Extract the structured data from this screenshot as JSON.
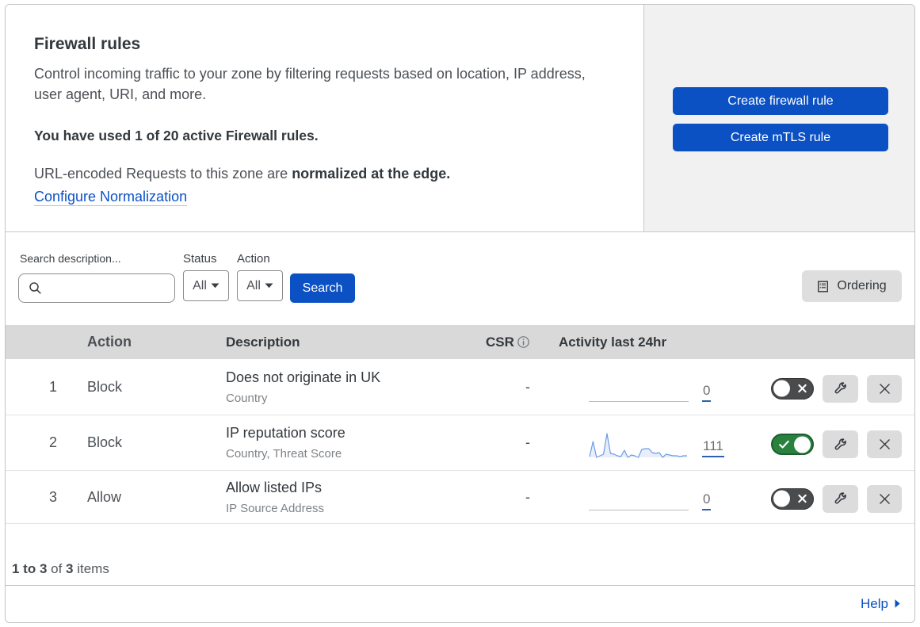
{
  "intro": {
    "title": "Firewall rules",
    "description": "Control incoming traffic to your zone by filtering requests based on location, IP address, user agent, URI, and more.",
    "usage": "You have used 1 of 20 active Firewall rules.",
    "normalization_prefix": "URL-encoded Requests to this zone are ",
    "normalization_bold": "normalized at the edge.",
    "normalization_link": "Configure Normalization"
  },
  "cta": {
    "create_firewall_rule": "Create firewall rule",
    "create_mtls_rule": "Create mTLS rule"
  },
  "filters": {
    "search_label": "Search description...",
    "search_value": "",
    "status_label": "Status",
    "status_value": "All",
    "action_label": "Action",
    "action_value": "All",
    "search_button": "Search",
    "ordering_button": "Ordering"
  },
  "table": {
    "columns": {
      "action": "Action",
      "description": "Description",
      "csr": "CSR",
      "activity": "Activity last 24hr"
    },
    "rows": [
      {
        "index": "1",
        "action": "Block",
        "description": "Does not originate in UK",
        "criteria": "Country",
        "csr": "-",
        "activity_count": "0",
        "enabled": false
      },
      {
        "index": "2",
        "action": "Block",
        "description": "IP reputation score",
        "criteria": "Country, Threat Score",
        "csr": "-",
        "activity_count": "111",
        "enabled": true
      },
      {
        "index": "3",
        "action": "Allow",
        "description": "Allow listed IPs",
        "criteria": "IP Source Address",
        "csr": "-",
        "activity_count": "0",
        "enabled": false
      }
    ]
  },
  "footer": {
    "range_bold": "1 to 3",
    "of_text": " of ",
    "total_bold": "3",
    "items_text": " items",
    "help_label": "Help"
  },
  "chart_data": {
    "type": "area",
    "title": "Activity last 24hr sparkline for rule 2 (IP reputation score)",
    "x": [
      0,
      1,
      2,
      3,
      4,
      5,
      6,
      7,
      8,
      9,
      10,
      11,
      12,
      13,
      14,
      15,
      16,
      17,
      18,
      19,
      20,
      21,
      22,
      23,
      24,
      25,
      26,
      27,
      28
    ],
    "values": [
      1,
      20,
      0,
      2,
      4,
      30,
      5,
      4,
      2,
      1,
      9,
      0,
      3,
      2,
      0,
      10,
      11,
      11,
      6,
      5,
      6,
      0,
      4,
      3,
      2,
      2,
      1,
      2,
      2
    ],
    "xlabel": "",
    "ylabel": "",
    "ylim": [
      0,
      30
    ],
    "total_label": "111",
    "line_color": "#6d9be4",
    "fill_color": "rgba(109,155,228,0.16)"
  },
  "colors": {
    "accent_blue": "#0b51c4",
    "panel_gray": "#f1f1f1",
    "table_header_gray": "#d9d9d9",
    "toggle_on_green": "#28823e",
    "toggle_off_gray": "#4a4b4d",
    "count_underline": "#2d63ad"
  }
}
